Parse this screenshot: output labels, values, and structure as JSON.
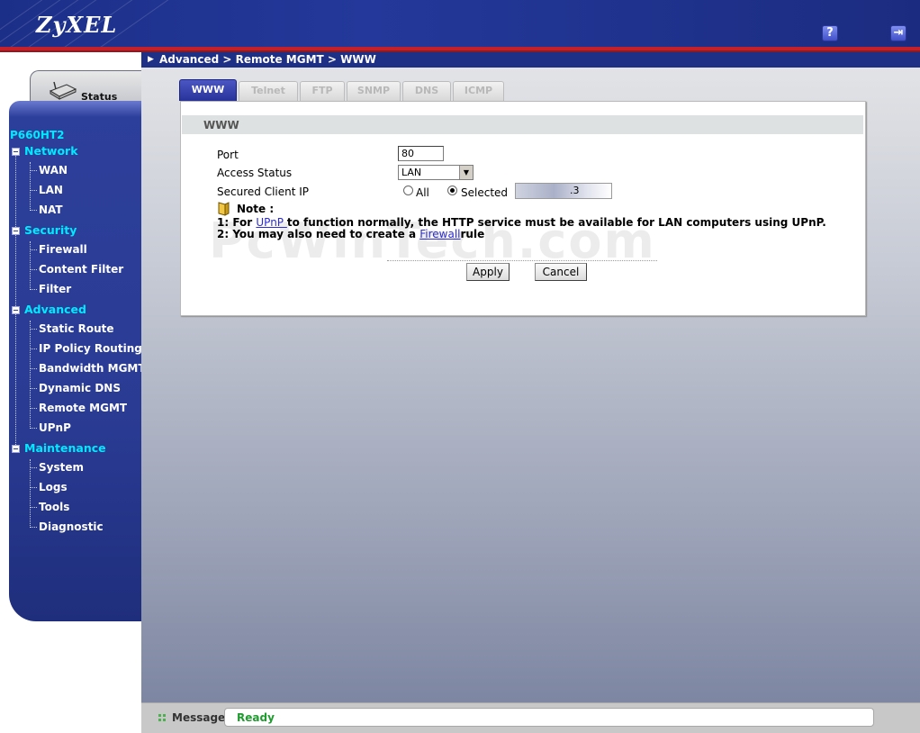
{
  "header": {
    "brand": "ZyXEL",
    "help_label": "?",
    "logout_label": "⇥"
  },
  "breadcrumb": "Advanced > Remote MGMT > WWW",
  "status_tab": {
    "label": "Status"
  },
  "sidebar": {
    "model": "P660HT2",
    "sections": [
      {
        "label": "Network",
        "items": [
          "WAN",
          "LAN",
          "NAT"
        ]
      },
      {
        "label": "Security",
        "items": [
          "Firewall",
          "Content Filter",
          "Filter"
        ]
      },
      {
        "label": "Advanced",
        "items": [
          "Static Route",
          "IP Policy Routing",
          "Bandwidth MGMT",
          "Dynamic DNS",
          "Remote MGMT",
          "UPnP"
        ]
      },
      {
        "label": "Maintenance",
        "items": [
          "System",
          "Logs",
          "Tools",
          "Diagnostic"
        ]
      }
    ]
  },
  "tabs": [
    "WWW",
    "Telnet",
    "FTP",
    "SNMP",
    "DNS",
    "ICMP"
  ],
  "panel": {
    "title": "WWW",
    "port_label": "Port",
    "port_value": "80",
    "access_label": "Access Status",
    "access_value": "LAN",
    "secured_label": "Secured Client IP",
    "radio_all": "All",
    "radio_selected": "Selected",
    "ip_value": ".3",
    "note_title": "Note :",
    "note1_pre": "1: For ",
    "note1_link": "UPnP ",
    "note1_post": " to function normally, the HTTP service must be available for LAN computers using UPnP.",
    "note2_pre": "2: You may also need to create a ",
    "note2_link": "Firewall",
    "note2_post": "rule",
    "watermark": "PcWinTech.com",
    "apply": "Apply",
    "cancel": "Cancel"
  },
  "footer": {
    "message_label": "Message",
    "message_value": "Ready"
  },
  "colors": {
    "header_blue": "#23389a",
    "accent_red": "#c4202a",
    "nav_cyan": "#00eaff",
    "ready_green": "#1f9b2f"
  }
}
